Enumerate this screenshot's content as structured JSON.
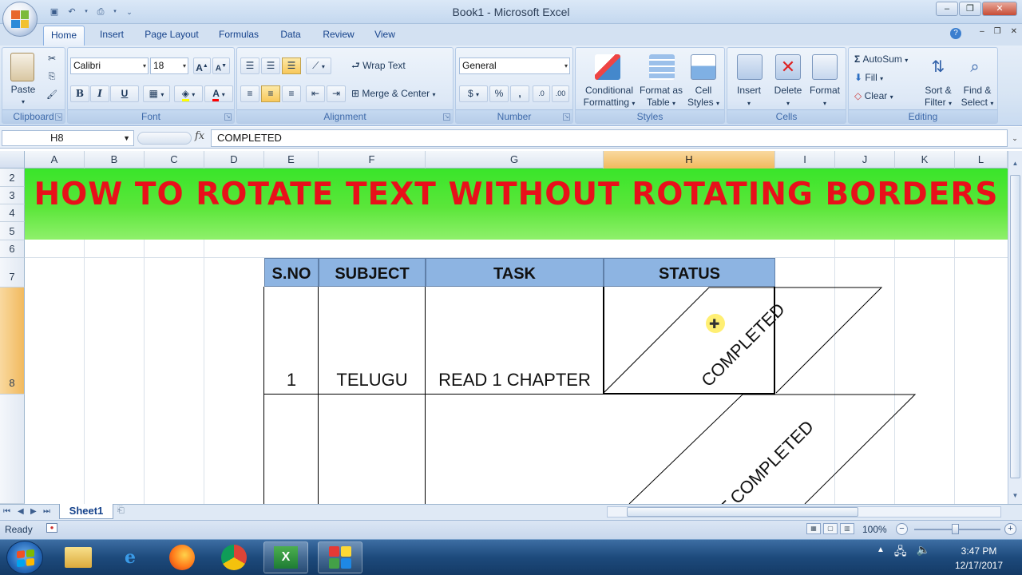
{
  "window": {
    "title": "Book1 - Microsoft Excel",
    "buttons": {
      "minimize": "–",
      "restore": "❐",
      "close": "✕"
    }
  },
  "ribbon": {
    "tabs": [
      {
        "label": "Home",
        "active": true
      },
      {
        "label": "Insert"
      },
      {
        "label": "Page Layout"
      },
      {
        "label": "Formulas"
      },
      {
        "label": "Data"
      },
      {
        "label": "Review"
      },
      {
        "label": "View"
      }
    ],
    "clipboard": {
      "paste": "Paste",
      "group": "Clipboard"
    },
    "font": {
      "name": "Calibri",
      "size": "18",
      "bold": "B",
      "italic": "I",
      "underline": "U",
      "group": "Font",
      "font_color": "#ff0000"
    },
    "alignment": {
      "wrap_text": "Wrap Text",
      "merge_center": "Merge & Center",
      "group": "Alignment"
    },
    "number": {
      "format": "General",
      "currency": "$",
      "percent": "%",
      "comma": ",",
      "group": "Number"
    },
    "styles": {
      "conditional": "Conditional",
      "conditional2": "Formatting",
      "format_table": "Format as",
      "format_table2": "Table",
      "cell_styles": "Cell",
      "cell_styles2": "Styles",
      "group": "Styles"
    },
    "cells": {
      "insert": "Insert",
      "delete": "Delete",
      "format": "Format",
      "group": "Cells"
    },
    "editing": {
      "autosum": "AutoSum",
      "fill": "Fill",
      "clear": "Clear",
      "sort_filter": "Sort &",
      "sort_filter2": "Filter",
      "find_select": "Find &",
      "find_select2": "Select",
      "group": "Editing"
    }
  },
  "formula_bar": {
    "name_box": "H8",
    "fx": "fx",
    "value": "COMPLETED"
  },
  "columns": [
    "A",
    "B",
    "C",
    "D",
    "E",
    "F",
    "G",
    "H",
    "I",
    "J",
    "K",
    "L"
  ],
  "rows": [
    "2",
    "3",
    "4",
    "5",
    "6",
    "7",
    "8"
  ],
  "sheet": {
    "banner": "HOW TO ROTATE TEXT WITHOUT ROTATING BORDERS",
    "headers": [
      "S.NO",
      "SUBJECT",
      "TASK",
      "STATUS"
    ],
    "row1": {
      "sno": "1",
      "subject": "TELUGU",
      "task": "READ 1 CHAPTER",
      "status": "COMPLETED"
    },
    "row2_status": "NOT COMPLETED"
  },
  "sheet_tabs": [
    "Sheet1"
  ],
  "status_bar": {
    "ready": "Ready",
    "zoom": "100%"
  },
  "taskbar": {
    "time": "3:47 PM",
    "date": "12/17/2017"
  }
}
